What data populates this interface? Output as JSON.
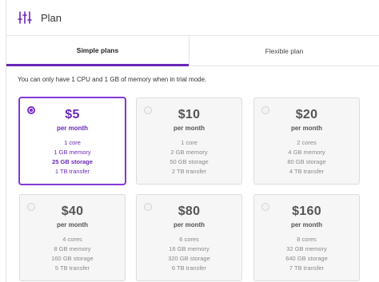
{
  "header": {
    "title": "Plan",
    "icon": "sliders-icon"
  },
  "tabs": [
    {
      "label": "Simple plans",
      "active": true
    },
    {
      "label": "Flexible plan",
      "active": false
    }
  ],
  "notice": "You can only have 1 CPU and 1 GB of memory when in trial mode.",
  "accent_color": "#6a27b8",
  "plans": [
    {
      "price": "$5",
      "period": "per month",
      "cores": "1 core",
      "memory": "1 GB memory",
      "storage": "25 GB storage",
      "transfer": "1 TB transfer",
      "selected": true
    },
    {
      "price": "$10",
      "period": "per month",
      "cores": "1 core",
      "memory": "2 GB memory",
      "storage": "50 GB storage",
      "transfer": "2 TB transfer",
      "selected": false
    },
    {
      "price": "$20",
      "period": "per month",
      "cores": "2 cores",
      "memory": "4 GB memory",
      "storage": "80 GB storage",
      "transfer": "4 TB transfer",
      "selected": false
    },
    {
      "price": "$40",
      "period": "per month",
      "cores": "4 cores",
      "memory": "8 GB memory",
      "storage": "160 GB storage",
      "transfer": "5 TB transfer",
      "selected": false
    },
    {
      "price": "$80",
      "period": "per month",
      "cores": "6 cores",
      "memory": "16 GB memory",
      "storage": "320 GB storage",
      "transfer": "6 TB transfer",
      "selected": false
    },
    {
      "price": "$160",
      "period": "per month",
      "cores": "8 cores",
      "memory": "32 GB memory",
      "storage": "640 GB storage",
      "transfer": "7 TB transfer",
      "selected": false
    }
  ]
}
